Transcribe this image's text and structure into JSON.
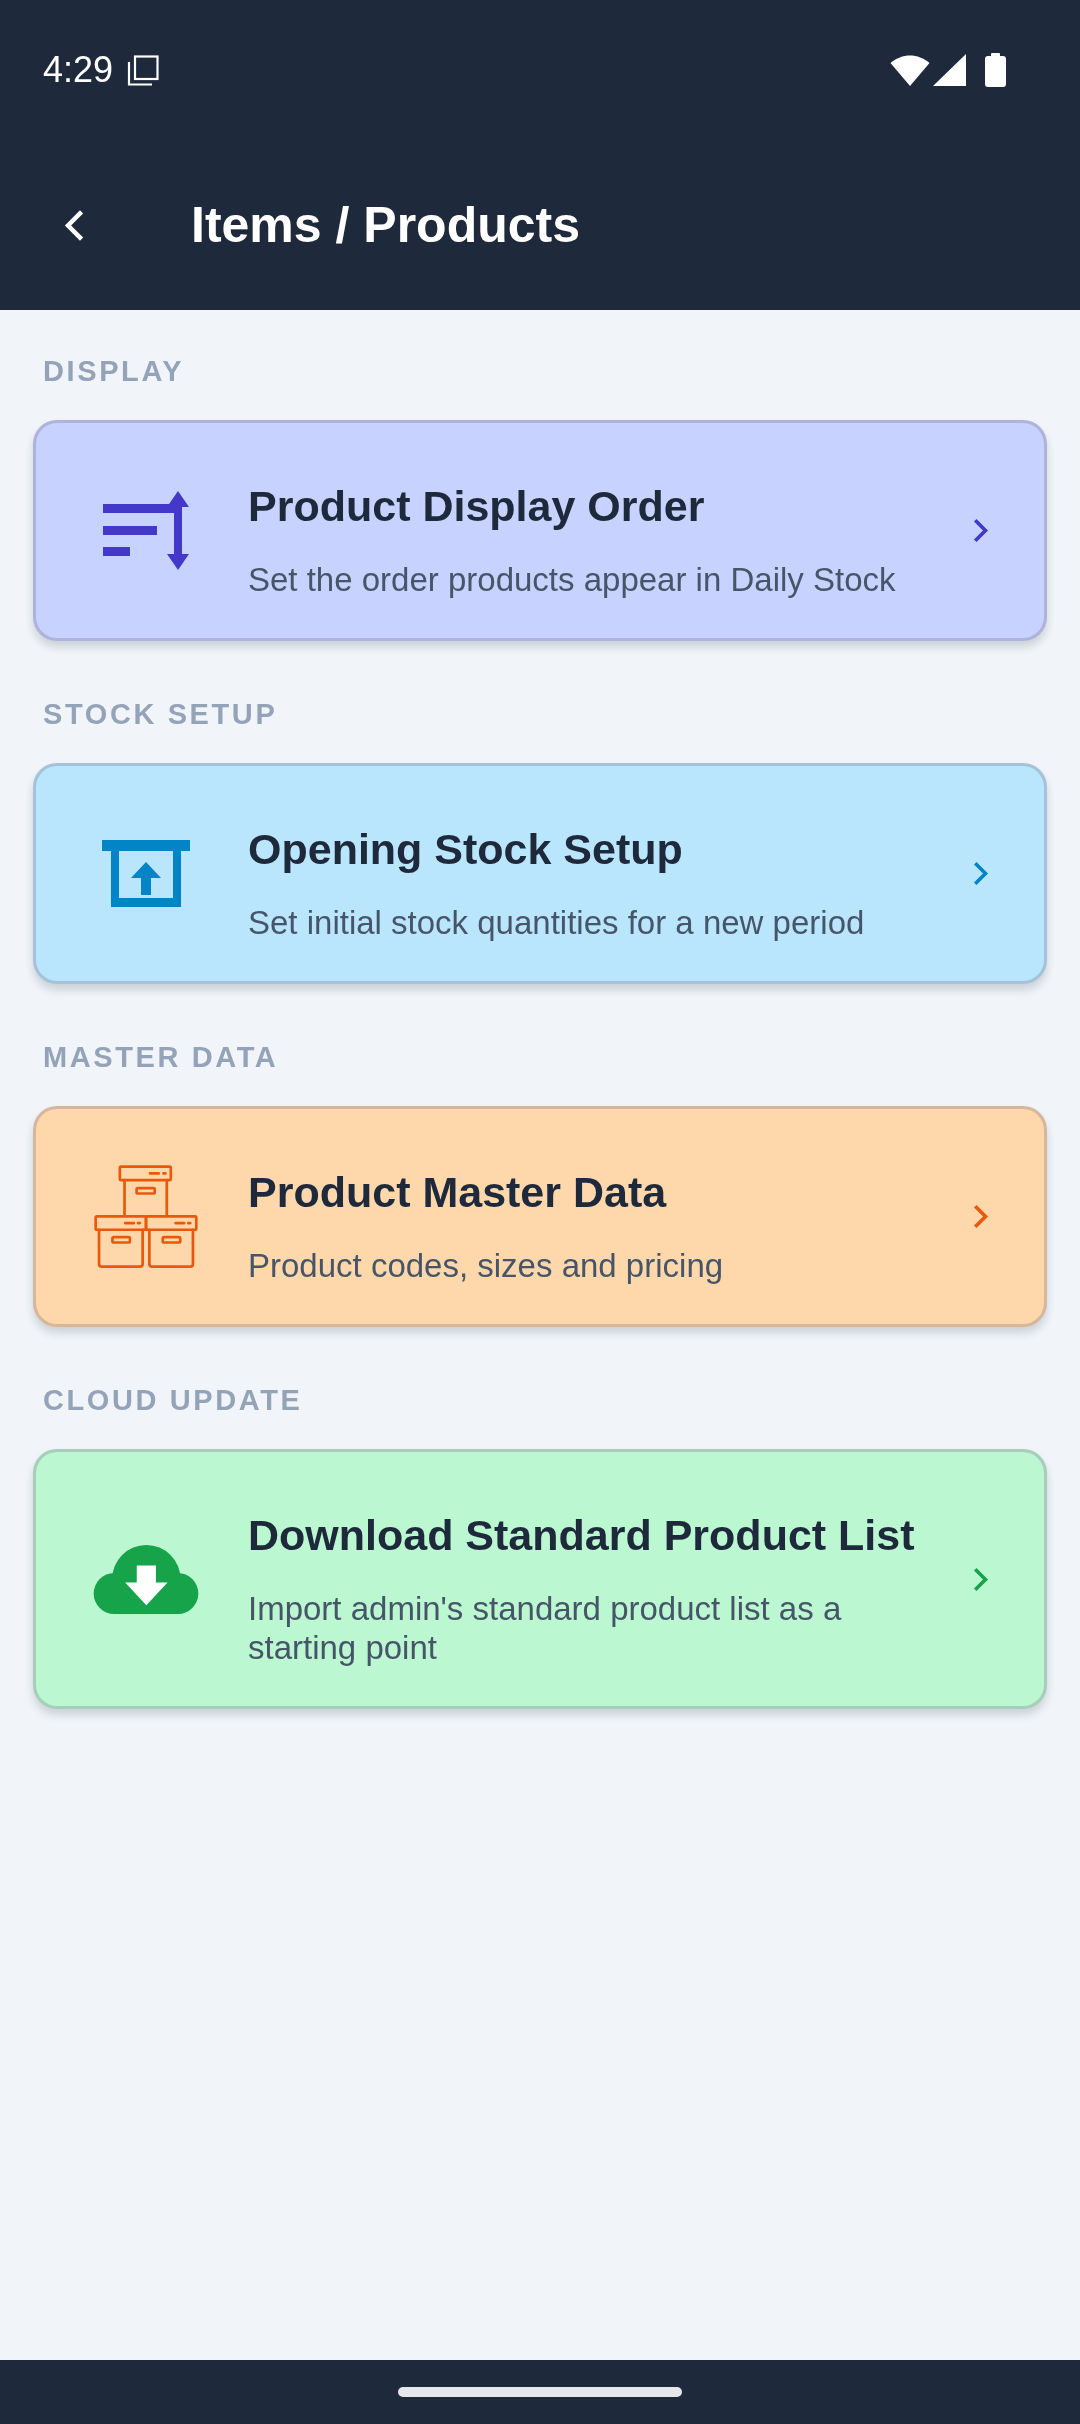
{
  "status_bar": {
    "time": "4:29"
  },
  "app_bar": {
    "title": "Items / Products"
  },
  "sections": [
    {
      "label": "DISPLAY",
      "card": {
        "kind": "sort",
        "title": "Product Display Order",
        "subtitle": "Set the order products appear in Daily Stock",
        "color": "#4338ca"
      }
    },
    {
      "label": "STOCK SETUP",
      "card": {
        "kind": "opening",
        "title": "Opening Stock Setup",
        "subtitle": "Set initial stock quantities for a new period",
        "color": "#0284c7"
      }
    },
    {
      "label": "MASTER DATA",
      "card": {
        "kind": "master",
        "title": "Product Master Data",
        "subtitle": "Product codes, sizes and pricing",
        "color": "#ea580c"
      }
    },
    {
      "label": "CLOUD UPDATE",
      "card": {
        "kind": "download",
        "title": "Download Standard Product List",
        "subtitle": "Import admin's standard product list as a starting point",
        "color": "#16a34a"
      }
    }
  ]
}
